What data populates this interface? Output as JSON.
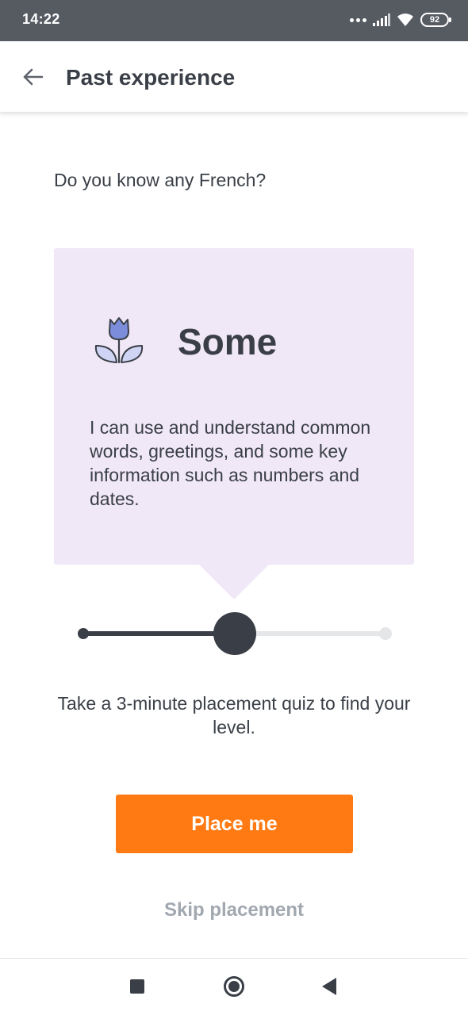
{
  "status_bar": {
    "time": "14:22",
    "battery": "92",
    "icons": [
      "more-dots-icon",
      "signal-icon",
      "wifi-icon",
      "battery-icon"
    ]
  },
  "app_bar": {
    "title": "Past experience",
    "back_icon": "arrow-left-icon"
  },
  "main": {
    "question": "Do you know any French?",
    "card": {
      "icon": "tulip-icon",
      "level": "Some",
      "description": "I can use and understand common words, greetings, and some key information such as numbers and dates."
    },
    "slider": {
      "steps": 3,
      "value": 0.5
    },
    "quiz_text": "Take a 3-minute placement quiz to find your level.",
    "place_button": "Place me",
    "skip_link": "Skip placement"
  },
  "nav_bar": {
    "icons": [
      "recent-apps-icon",
      "home-icon",
      "back-triangle-icon"
    ]
  },
  "colors": {
    "status_bar": "#565b62",
    "card_bg": "#f0e7f7",
    "text_dark": "#3a3f47",
    "accent_orange": "#ff7a12",
    "skip_grey": "#a2a8b0",
    "icon_blue": "#7b8ddb"
  }
}
